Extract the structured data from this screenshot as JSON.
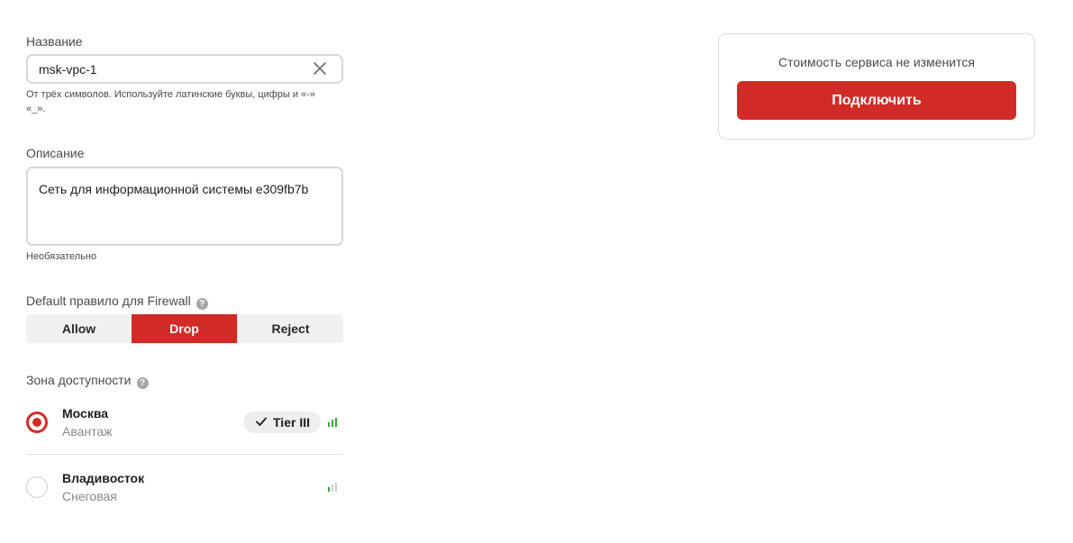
{
  "name_field": {
    "label": "Название",
    "value": "msk-vpc-1",
    "hint_line1": "От трёх символов. Используйте латинские буквы, цифры и «-»",
    "hint_line2": "«_»."
  },
  "description_field": {
    "label": "Описание",
    "value": "Сеть для информационной системы e309fb7b",
    "hint": "Необязательно"
  },
  "firewall": {
    "label": "Default правило для Firewall",
    "help": "?",
    "options": [
      {
        "label": "Allow",
        "selected": false
      },
      {
        "label": "Drop",
        "selected": true
      },
      {
        "label": "Reject",
        "selected": false
      }
    ]
  },
  "zone": {
    "label": "Зона доступности",
    "help": "?",
    "items": [
      {
        "name": "Москва",
        "sub": "Авантаж",
        "selected": true,
        "tier": "Tier III",
        "signal": "full"
      },
      {
        "name": "Владивосток",
        "sub": "Снеговая",
        "selected": false,
        "signal": "low"
      }
    ]
  },
  "summary": {
    "cost_text": "Стоимость сервиса не изменится",
    "connect_label": "Подключить"
  },
  "colors": {
    "accent": "#d22b27",
    "signal_green": "#3aa53a",
    "signal_gray": "#cfcfd3"
  }
}
